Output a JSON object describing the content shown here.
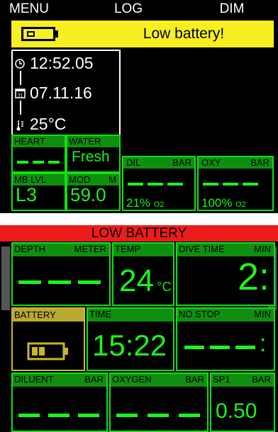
{
  "screen1": {
    "menu": {
      "left": "MENU",
      "center": "LOG",
      "right": "DIM"
    },
    "alert": {
      "text": "Low battery!",
      "icon": "battery-low-icon"
    },
    "info": {
      "time": "12:52.05",
      "date": "07.11.16",
      "temperature": "25°C",
      "calendar_day": "31"
    },
    "panels": {
      "heart": {
        "label": "HEART"
      },
      "water": {
        "label": "WATER",
        "value": "Fresh"
      },
      "mb_level": {
        "label": "MB LVL",
        "value": "L3"
      },
      "mod": {
        "label": "MOD",
        "unit": "M",
        "value": "59.0"
      },
      "dil": {
        "label": "DIL",
        "unit": "BAR",
        "value": "21%",
        "suffix": "O2"
      },
      "oxy": {
        "label": "OXY",
        "unit": "BAR",
        "value": "100%",
        "suffix": "O2"
      }
    }
  },
  "screen2": {
    "header": "LOW BATTERY",
    "panels": {
      "depth": {
        "label": "DEPTH",
        "unit": "METER"
      },
      "temp": {
        "label": "TEMP",
        "value": "24",
        "unit_suffix": "°C"
      },
      "dive_time": {
        "label": "DIVE TIME",
        "unit": "MIN",
        "value": "2:"
      },
      "battery": {
        "label": "BATTERY",
        "icon": "battery-low-icon"
      },
      "time": {
        "label": "TIME",
        "value": "15:22"
      },
      "no_stop": {
        "label": "NO STOP",
        "unit": "MIN"
      },
      "diluent": {
        "label": "DILUENT",
        "unit": "BAR"
      },
      "oxygen": {
        "label": "OXYGEN",
        "unit": "BAR"
      },
      "sp1": {
        "label": "SP1",
        "unit": "BAR",
        "value": "0.50"
      }
    }
  },
  "colors": {
    "green": "#1af51a",
    "header_green": "#0f8f0f",
    "alert_yellow": "#f7ef21",
    "alert_red": "#ee1b1b",
    "battery_yellow": "#c9b72b"
  }
}
